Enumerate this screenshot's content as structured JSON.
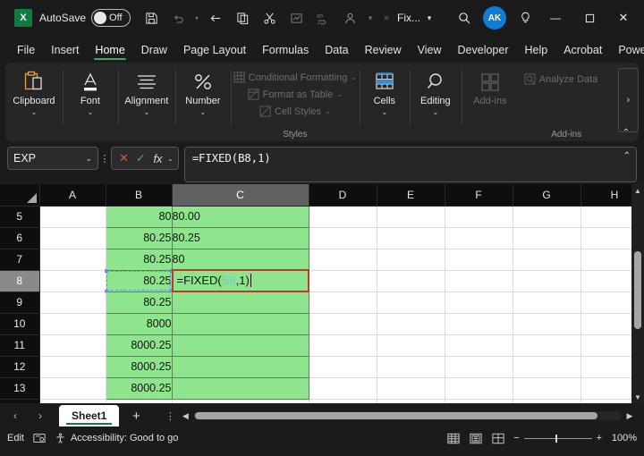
{
  "titlebar": {
    "app_icon": "excel-logo",
    "app_initial": "X",
    "autosave_label": "AutoSave",
    "autosave_state": "Off",
    "quick_access": [
      {
        "name": "save-icon",
        "glyph": "save"
      },
      {
        "name": "undo-icon",
        "glyph": "undo"
      },
      {
        "name": "undo-dropdown-icon",
        "glyph": "chevron-down"
      },
      {
        "name": "redo-icon",
        "glyph": "arrow-left"
      },
      {
        "name": "copy-icon",
        "glyph": "copy"
      },
      {
        "name": "cut-icon",
        "glyph": "scissors"
      },
      {
        "name": "chart-icon",
        "glyph": "chart"
      },
      {
        "name": "spelling-icon",
        "glyph": "abc"
      },
      {
        "name": "person-icon",
        "glyph": "person"
      },
      {
        "name": "qat-more-icon",
        "glyph": "chevron-down"
      }
    ],
    "overflow_label": "»",
    "file_name": "Fix...",
    "file_chevron": "⌄",
    "search_icon": "search-icon",
    "account_initials": "AK",
    "tips_icon": "lightbulb-icon",
    "minimize": "—",
    "maximize": "☐",
    "close": "✕"
  },
  "ribbon_tabs": {
    "items": [
      "File",
      "Insert",
      "Home",
      "Draw",
      "Page Layout",
      "Formulas",
      "Data",
      "Review",
      "View",
      "Developer",
      "Help",
      "Acrobat",
      "Power Pivot"
    ],
    "active": "Home",
    "comment_icon": "comment-icon",
    "share_icon": "share-icon",
    "share_chevron": "⌄"
  },
  "ribbon": {
    "groups": [
      {
        "label": "Clipboard",
        "icon": "clipboard-icon",
        "chevron": "⌄"
      },
      {
        "label": "Font",
        "icon": "font-icon",
        "chevron": "⌄"
      },
      {
        "label": "Alignment",
        "icon": "alignment-icon",
        "chevron": "⌄"
      },
      {
        "label": "Number",
        "icon": "percent-icon",
        "chevron": "⌄"
      }
    ],
    "styles": {
      "group_label": "Styles",
      "items": [
        {
          "label": "Conditional Formatting",
          "icon": "conditional-formatting-icon",
          "chevron": "⌄",
          "disabled": true
        },
        {
          "label": "Format as Table",
          "icon": "format-as-table-icon",
          "chevron": "⌄",
          "disabled": true
        },
        {
          "label": "Cell Styles",
          "icon": "cell-styles-icon",
          "chevron": "⌄",
          "disabled": true
        }
      ]
    },
    "cells": {
      "label": "Cells",
      "icon": "cells-icon",
      "chevron": "⌄"
    },
    "editing": {
      "label": "Editing",
      "icon": "editing-icon",
      "chevron": "⌄"
    },
    "addins": {
      "group_label": "Add-ins",
      "button_label": "Add-ins",
      "button_icon": "add-ins-icon",
      "analyze_label": "Analyze Data",
      "analyze_icon": "analyze-data-icon"
    },
    "overflow_chevron": "›",
    "collapse_chevron": "⌃"
  },
  "formula_bar": {
    "name_box_value": "EXP",
    "name_box_chevron": "⌄",
    "more_dots": "⋮",
    "cancel_icon": "✕",
    "enter_icon": "✓",
    "fx_label": "fx",
    "fx_chevron": "⌄",
    "formula": "=FIXED(B8,1)",
    "expand_chevron": "⌃"
  },
  "grid": {
    "select_all": "select-all-corner",
    "columns": [
      "A",
      "B",
      "C",
      "D",
      "E",
      "F",
      "G",
      "H"
    ],
    "active_column": "C",
    "active_row": "8",
    "rows": [
      {
        "num": "5",
        "cells": {
          "A": "",
          "B": "80",
          "C": "80.00",
          "D": "",
          "E": "",
          "F": "",
          "G": "",
          "H": ""
        }
      },
      {
        "num": "6",
        "cells": {
          "A": "",
          "B": "80.25",
          "C": "80.25",
          "D": "",
          "E": "",
          "F": "",
          "G": "",
          "H": ""
        }
      },
      {
        "num": "7",
        "cells": {
          "A": "",
          "B": "80.25",
          "C": "80",
          "D": "",
          "E": "",
          "F": "",
          "G": "",
          "H": ""
        }
      },
      {
        "num": "8",
        "cells": {
          "A": "",
          "B": "80.25",
          "C": "",
          "D": "",
          "E": "",
          "F": "",
          "G": "",
          "H": ""
        }
      },
      {
        "num": "9",
        "cells": {
          "A": "",
          "B": "80.25",
          "C": "",
          "D": "",
          "E": "",
          "F": "",
          "G": "",
          "H": ""
        }
      },
      {
        "num": "10",
        "cells": {
          "A": "",
          "B": "8000",
          "C": "",
          "D": "",
          "E": "",
          "F": "",
          "G": "",
          "H": ""
        }
      },
      {
        "num": "11",
        "cells": {
          "A": "",
          "B": "8000.25",
          "C": "",
          "D": "",
          "E": "",
          "F": "",
          "G": "",
          "H": ""
        }
      },
      {
        "num": "12",
        "cells": {
          "A": "",
          "B": "8000.25",
          "C": "",
          "D": "",
          "E": "",
          "F": "",
          "G": "",
          "H": ""
        }
      },
      {
        "num": "13",
        "cells": {
          "A": "",
          "B": "8000.25",
          "C": "",
          "D": "",
          "E": "",
          "F": "",
          "G": "",
          "H": ""
        }
      },
      {
        "num": "14",
        "cells": {
          "A": "",
          "B": "",
          "C": "",
          "D": "",
          "E": "",
          "F": "",
          "G": "",
          "H": ""
        }
      }
    ],
    "edit_cell": {
      "address": "C8",
      "prefix": "=FIXED(",
      "reference": "B8",
      "suffix": ",1)",
      "border_color": "#c0392b",
      "reference_color": "#7fbfe8"
    },
    "source_cell": {
      "address": "B8",
      "outline_color": "#5b9bd5"
    },
    "fill_color": "#8ee58e"
  },
  "sheet_tabs": {
    "prev_icon": "‹",
    "next_icon": "›",
    "tabs": [
      "Sheet1"
    ],
    "active": "Sheet1",
    "add_icon": "+",
    "more_dots": "⋮",
    "scroll_left": "◀",
    "scroll_right": "▶"
  },
  "status_bar": {
    "mode": "Edit",
    "macro_icon": "record-macro-icon",
    "accessibility_icon": "accessibility-icon",
    "accessibility_text": "Accessibility: Good to go",
    "views": [
      {
        "name": "normal-view-button",
        "icon": "grid-icon"
      },
      {
        "name": "page-layout-view-button",
        "icon": "page-icon"
      },
      {
        "name": "page-break-view-button",
        "icon": "pagebreak-icon"
      }
    ],
    "zoom_out": "−",
    "zoom_in": "+",
    "zoom_level": "100%"
  }
}
